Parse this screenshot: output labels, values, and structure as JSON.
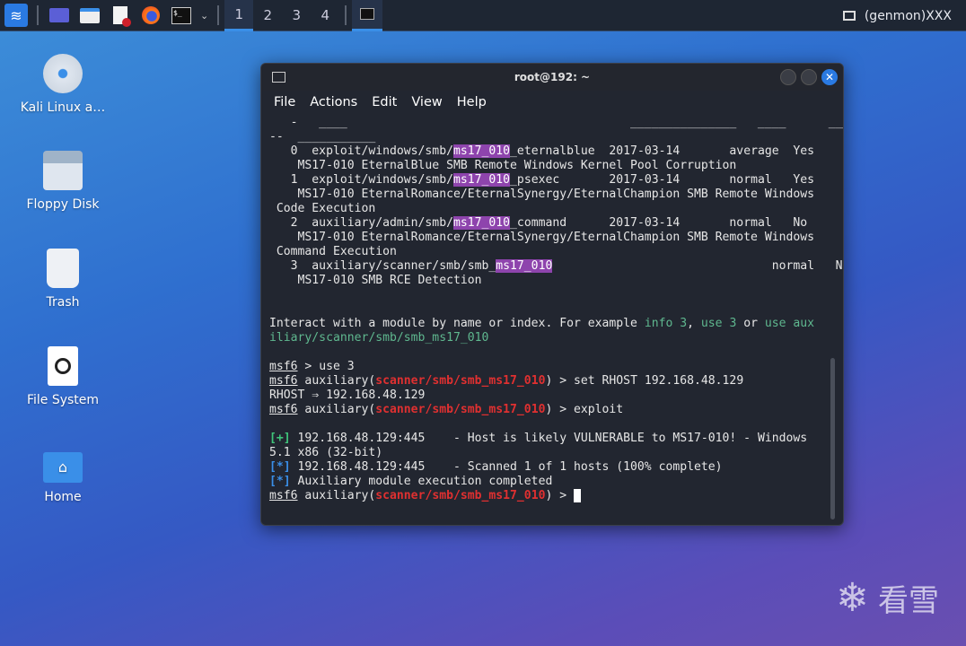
{
  "taskbar": {
    "workspaces": [
      "1",
      "2",
      "3",
      "4"
    ],
    "tray_label": "(genmon)XXX"
  },
  "desktop": {
    "icons": [
      "Kali Linux a…",
      "Floppy Disk",
      "Trash",
      "File System",
      "Home"
    ]
  },
  "window": {
    "title": "root@192: ~",
    "menu": [
      "File",
      "Actions",
      "Edit",
      "View",
      "Help"
    ]
  },
  "terminal": {
    "lines": [
      [
        [
          "   -   ____                                        _______________   ____      ___",
          ""
        ]
      ],
      [
        [
          "--  ___________",
          ""
        ]
      ],
      [
        [
          "   0  exploit/windows/smb/",
          ""
        ],
        [
          "ms17_010",
          "hl"
        ],
        [
          "_eternalblue  2017-03-14       average  Yes",
          ""
        ]
      ],
      [
        [
          "    MS17-010 EternalBlue SMB Remote Windows Kernel Pool Corruption",
          ""
        ]
      ],
      [
        [
          "   1  exploit/windows/smb/",
          ""
        ],
        [
          "ms17_010",
          "hl"
        ],
        [
          "_psexec       2017-03-14       normal   Yes",
          ""
        ]
      ],
      [
        [
          "    MS17-010 EternalRomance/EternalSynergy/EternalChampion SMB Remote Windows",
          ""
        ]
      ],
      [
        [
          " Code Execution",
          ""
        ]
      ],
      [
        [
          "   2  auxiliary/admin/smb/",
          ""
        ],
        [
          "ms17_010",
          "hl"
        ],
        [
          "_command      2017-03-14       normal   No",
          ""
        ]
      ],
      [
        [
          "    MS17-010 EternalRomance/EternalSynergy/EternalChampion SMB Remote Windows",
          ""
        ]
      ],
      [
        [
          " Command Execution",
          ""
        ]
      ],
      [
        [
          "   3  auxiliary/scanner/smb/smb_",
          ""
        ],
        [
          "ms17_010",
          "hl"
        ],
        [
          "                               normal   No",
          ""
        ]
      ],
      [
        [
          "    MS17-010 SMB RCE Detection",
          ""
        ]
      ],
      [
        [
          "",
          ""
        ]
      ],
      [
        [
          "",
          ""
        ]
      ],
      [
        [
          "Interact with a module by name or index. For example ",
          ""
        ],
        [
          "info 3",
          "g"
        ],
        [
          ", ",
          ""
        ],
        [
          "use 3",
          "g"
        ],
        [
          " or ",
          ""
        ],
        [
          "use aux",
          "g"
        ]
      ],
      [
        [
          "iliary/scanner/smb/smb_ms17_010",
          "g"
        ]
      ],
      [
        [
          "",
          ""
        ]
      ],
      [
        [
          "msf6",
          "u"
        ],
        [
          " > use 3",
          ""
        ]
      ],
      [
        [
          "msf6",
          "u"
        ],
        [
          " auxiliary(",
          ""
        ],
        [
          "scanner/smb/smb_ms17_010",
          "r"
        ],
        [
          ") > set RHOST 192.168.48.129",
          ""
        ]
      ],
      [
        [
          "RHOST ⇒ 192.168.48.129",
          ""
        ]
      ],
      [
        [
          "msf6",
          "u"
        ],
        [
          " auxiliary(",
          ""
        ],
        [
          "scanner/smb/smb_ms17_010",
          "r"
        ],
        [
          ") > exploit",
          ""
        ]
      ],
      [
        [
          "",
          ""
        ]
      ],
      [
        [
          "[+]",
          "gb"
        ],
        [
          " 192.168.48.129:445    - Host is likely VULNERABLE to MS17-010! - Windows",
          ""
        ]
      ],
      [
        [
          "5.1 x86 (32-bit)",
          ""
        ]
      ],
      [
        [
          "[*]",
          "b"
        ],
        [
          " 192.168.48.129:445    - Scanned 1 of 1 hosts (100% complete)",
          ""
        ]
      ],
      [
        [
          "[*]",
          "b"
        ],
        [
          " Auxiliary module execution completed",
          ""
        ]
      ],
      [
        [
          "msf6",
          "u"
        ],
        [
          " auxiliary(",
          ""
        ],
        [
          "scanner/smb/smb_ms17_010",
          "r"
        ],
        [
          ") > ",
          ""
        ],
        [
          " ",
          "cursor"
        ]
      ]
    ]
  },
  "watermark": {
    "text": "看雪"
  }
}
